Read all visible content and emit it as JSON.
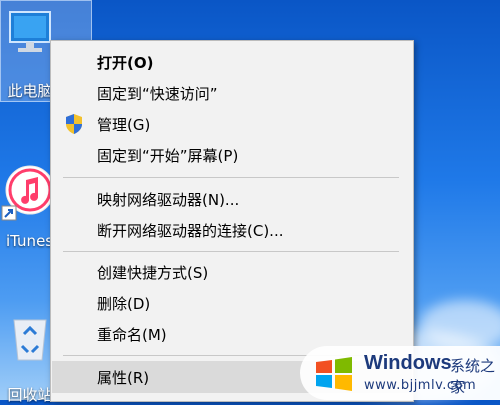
{
  "desktop": {
    "icons": [
      {
        "label": "此电脑"
      },
      {
        "label": "iTunes"
      },
      {
        "label": "回收站"
      }
    ]
  },
  "context_menu": {
    "items": [
      {
        "label": "打开(O)",
        "bold": true
      },
      {
        "label": "固定到“快速访问”"
      },
      {
        "label": "管理(G)",
        "icon": "uac-shield-icon"
      },
      {
        "label": "固定到“开始”屏幕(P)"
      },
      {
        "label": "映射网络驱动器(N)..."
      },
      {
        "label": "断开网络驱动器的连接(C)..."
      },
      {
        "label": "创建快捷方式(S)"
      },
      {
        "label": "删除(D)"
      },
      {
        "label": "重命名(M)"
      },
      {
        "label": "属性(R)",
        "highlighted": true
      }
    ]
  },
  "watermark": {
    "title": "Windows",
    "subtitle": "系统之家",
    "url": "www.bjjmlv.com"
  },
  "colors": {
    "menu_bg": "#f2f2f2",
    "menu_hover": "#dadada",
    "desktop_top": "#0a56c6",
    "desktop_bottom": "#9fcdf8"
  }
}
